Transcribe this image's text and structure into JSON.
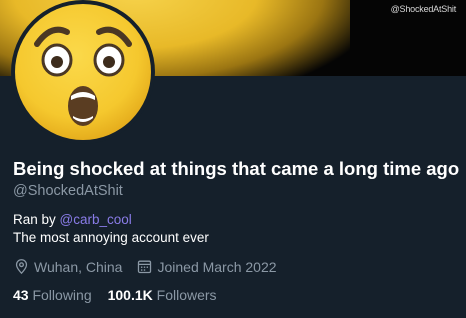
{
  "banner": {
    "watermark": "@ShockedAtShit"
  },
  "avatar": {
    "icon": "astonished-face-emoji"
  },
  "profile": {
    "display_name": "Being shocked at things that came a long time ago",
    "handle": "@ShockedAtShit",
    "bio_prefix": "Ran by ",
    "bio_mention": "@carb_cool",
    "bio_line2": "The most annoying account ever"
  },
  "meta": {
    "location": "Wuhan, China",
    "location_icon": "location-pin-icon",
    "joined": "Joined March 2022",
    "joined_icon": "calendar-icon"
  },
  "stats": {
    "following_count": "43",
    "following_label": "Following",
    "followers_count": "100.1K",
    "followers_label": "Followers"
  },
  "colors": {
    "background": "#15202b",
    "secondary_text": "#8b98a5",
    "mention": "#8a7ce8",
    "emoji_yellow": "#f5c82e"
  }
}
